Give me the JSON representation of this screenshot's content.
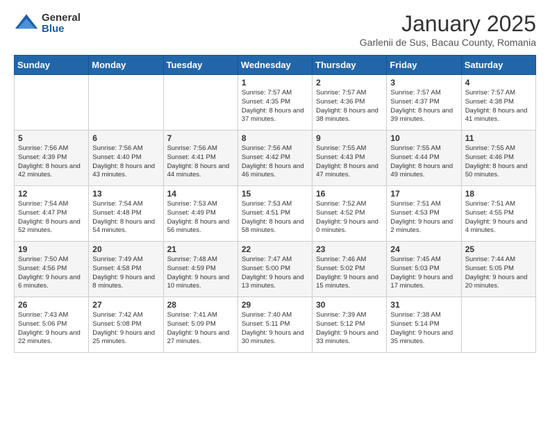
{
  "logo": {
    "general": "General",
    "blue": "Blue"
  },
  "header": {
    "month": "January 2025",
    "location": "Garlenii de Sus, Bacau County, Romania"
  },
  "days_of_week": [
    "Sunday",
    "Monday",
    "Tuesday",
    "Wednesday",
    "Thursday",
    "Friday",
    "Saturday"
  ],
  "weeks": [
    [
      {
        "day": "",
        "info": ""
      },
      {
        "day": "",
        "info": ""
      },
      {
        "day": "",
        "info": ""
      },
      {
        "day": "1",
        "info": "Sunrise: 7:57 AM\nSunset: 4:35 PM\nDaylight: 8 hours and 37 minutes."
      },
      {
        "day": "2",
        "info": "Sunrise: 7:57 AM\nSunset: 4:36 PM\nDaylight: 8 hours and 38 minutes."
      },
      {
        "day": "3",
        "info": "Sunrise: 7:57 AM\nSunset: 4:37 PM\nDaylight: 8 hours and 39 minutes."
      },
      {
        "day": "4",
        "info": "Sunrise: 7:57 AM\nSunset: 4:38 PM\nDaylight: 8 hours and 41 minutes."
      }
    ],
    [
      {
        "day": "5",
        "info": "Sunrise: 7:56 AM\nSunset: 4:39 PM\nDaylight: 8 hours and 42 minutes."
      },
      {
        "day": "6",
        "info": "Sunrise: 7:56 AM\nSunset: 4:40 PM\nDaylight: 8 hours and 43 minutes."
      },
      {
        "day": "7",
        "info": "Sunrise: 7:56 AM\nSunset: 4:41 PM\nDaylight: 8 hours and 44 minutes."
      },
      {
        "day": "8",
        "info": "Sunrise: 7:56 AM\nSunset: 4:42 PM\nDaylight: 8 hours and 46 minutes."
      },
      {
        "day": "9",
        "info": "Sunrise: 7:55 AM\nSunset: 4:43 PM\nDaylight: 8 hours and 47 minutes."
      },
      {
        "day": "10",
        "info": "Sunrise: 7:55 AM\nSunset: 4:44 PM\nDaylight: 8 hours and 49 minutes."
      },
      {
        "day": "11",
        "info": "Sunrise: 7:55 AM\nSunset: 4:46 PM\nDaylight: 8 hours and 50 minutes."
      }
    ],
    [
      {
        "day": "12",
        "info": "Sunrise: 7:54 AM\nSunset: 4:47 PM\nDaylight: 8 hours and 52 minutes."
      },
      {
        "day": "13",
        "info": "Sunrise: 7:54 AM\nSunset: 4:48 PM\nDaylight: 8 hours and 54 minutes."
      },
      {
        "day": "14",
        "info": "Sunrise: 7:53 AM\nSunset: 4:49 PM\nDaylight: 8 hours and 56 minutes."
      },
      {
        "day": "15",
        "info": "Sunrise: 7:53 AM\nSunset: 4:51 PM\nDaylight: 8 hours and 58 minutes."
      },
      {
        "day": "16",
        "info": "Sunrise: 7:52 AM\nSunset: 4:52 PM\nDaylight: 9 hours and 0 minutes."
      },
      {
        "day": "17",
        "info": "Sunrise: 7:51 AM\nSunset: 4:53 PM\nDaylight: 9 hours and 2 minutes."
      },
      {
        "day": "18",
        "info": "Sunrise: 7:51 AM\nSunset: 4:55 PM\nDaylight: 9 hours and 4 minutes."
      }
    ],
    [
      {
        "day": "19",
        "info": "Sunrise: 7:50 AM\nSunset: 4:56 PM\nDaylight: 9 hours and 6 minutes."
      },
      {
        "day": "20",
        "info": "Sunrise: 7:49 AM\nSunset: 4:58 PM\nDaylight: 9 hours and 8 minutes."
      },
      {
        "day": "21",
        "info": "Sunrise: 7:48 AM\nSunset: 4:59 PM\nDaylight: 9 hours and 10 minutes."
      },
      {
        "day": "22",
        "info": "Sunrise: 7:47 AM\nSunset: 5:00 PM\nDaylight: 9 hours and 13 minutes."
      },
      {
        "day": "23",
        "info": "Sunrise: 7:46 AM\nSunset: 5:02 PM\nDaylight: 9 hours and 15 minutes."
      },
      {
        "day": "24",
        "info": "Sunrise: 7:45 AM\nSunset: 5:03 PM\nDaylight: 9 hours and 17 minutes."
      },
      {
        "day": "25",
        "info": "Sunrise: 7:44 AM\nSunset: 5:05 PM\nDaylight: 9 hours and 20 minutes."
      }
    ],
    [
      {
        "day": "26",
        "info": "Sunrise: 7:43 AM\nSunset: 5:06 PM\nDaylight: 9 hours and 22 minutes."
      },
      {
        "day": "27",
        "info": "Sunrise: 7:42 AM\nSunset: 5:08 PM\nDaylight: 9 hours and 25 minutes."
      },
      {
        "day": "28",
        "info": "Sunrise: 7:41 AM\nSunset: 5:09 PM\nDaylight: 9 hours and 27 minutes."
      },
      {
        "day": "29",
        "info": "Sunrise: 7:40 AM\nSunset: 5:11 PM\nDaylight: 9 hours and 30 minutes."
      },
      {
        "day": "30",
        "info": "Sunrise: 7:39 AM\nSunset: 5:12 PM\nDaylight: 9 hours and 33 minutes."
      },
      {
        "day": "31",
        "info": "Sunrise: 7:38 AM\nSunset: 5:14 PM\nDaylight: 9 hours and 35 minutes."
      },
      {
        "day": "",
        "info": ""
      }
    ]
  ]
}
